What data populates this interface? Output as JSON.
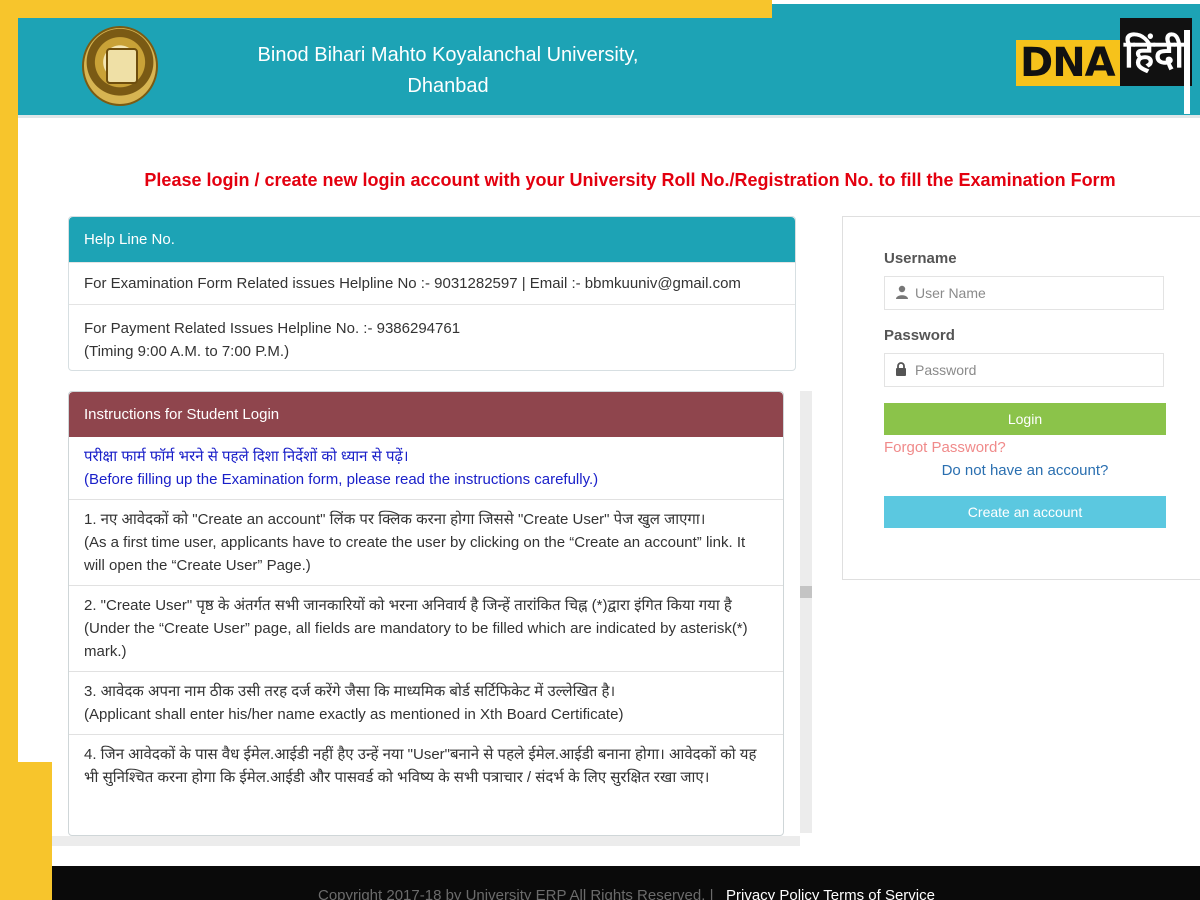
{
  "header": {
    "university_name_line1": "Binod Bihari Mahto Koyalanchal University,",
    "university_name_line2": "Dhanbad",
    "brand_logo_en": "DNA",
    "brand_logo_hi": "हिंदी"
  },
  "banner": "Please login / create new login account with your University Roll No./Registration No. to fill the Examination Form",
  "helpline": {
    "title": "Help Line No.",
    "exam_line": "For Examination Form Related issues Helpline No :- 9031282597 | Email :- bbmkuuniv@gmail.com",
    "payment_line": "For Payment Related Issues Helpline No. :- 9386294761",
    "timing": "(Timing 9:00 A.M. to 7:00 P.M.)"
  },
  "instructions": {
    "title": "Instructions for Student Login",
    "intro_hi": "परीक्षा फार्म फॉर्म भरने से पहले दिशा निर्देशों को ध्यान से पढ़ें।",
    "intro_en": "(Before filling up the Examination form, please read the instructions carefully.)",
    "items": [
      {
        "hi": "1. नए आवेदकों को \"Create an account\" लिंक पर क्लिक करना होगा जिससे \"Create User\" पेज खुल जाएगा।",
        "en": "(As a first time user, applicants have to create the user by clicking on the “Create an account” link. It will open the “Create User” Page.)"
      },
      {
        "hi": "2. \"Create User\" पृष्ठ के अंतर्गत सभी जानकारियों को भरना अनिवार्य है जिन्हें तारांकित चिह्न (*)द्वारा इंगित किया गया है",
        "en": "(Under the “Create User” page, all fields are mandatory to be filled which are indicated by asterisk(*) mark.)"
      },
      {
        "hi": "3. आवेदक अपना नाम ठीक उसी तरह दर्ज करेंगे जैसा कि माध्यमिक बोर्ड सर्टिफिकेट में उल्लेखित है।",
        "en": "(Applicant shall enter his/her name exactly as mentioned in Xth Board Certificate)"
      },
      {
        "hi": "4. जिन आवेदकों के पास वैध ईमेल.आईडी नहीं हैए उन्हें नया \"User\"बनाने से पहले ईमेल.आईडी बनाना होगा। आवेदकों को यह भी सुनिश्चित करना होगा कि ईमेल.आईडी और पासवर्ड को भविष्य के सभी पत्राचार / संदर्भ के लिए सुरक्षित रखा जाए।",
        "en": ""
      }
    ]
  },
  "login": {
    "username_label": "Username",
    "username_placeholder": "User Name",
    "password_label": "Password",
    "password_placeholder": "Password",
    "login_button": "Login",
    "forgot_link": "Forgot Password?",
    "no_account_link": "Do not have an account?",
    "create_button": "Create an account"
  },
  "footer": {
    "copyright": "Copyright 2017-18 by University ERP All Rights Reserved. |",
    "privacy_link": "Privacy Policy",
    "terms_link": "Terms of Service"
  },
  "colors": {
    "header_teal": "#1da3b5",
    "banner_red": "#e3000f",
    "instructions_head": "#8f454d",
    "login_green": "#8bc34a",
    "create_blue": "#5bc8e0",
    "frame_yellow": "#f7c52c"
  },
  "icons": {
    "username": "user-icon",
    "password": "lock-icon"
  }
}
